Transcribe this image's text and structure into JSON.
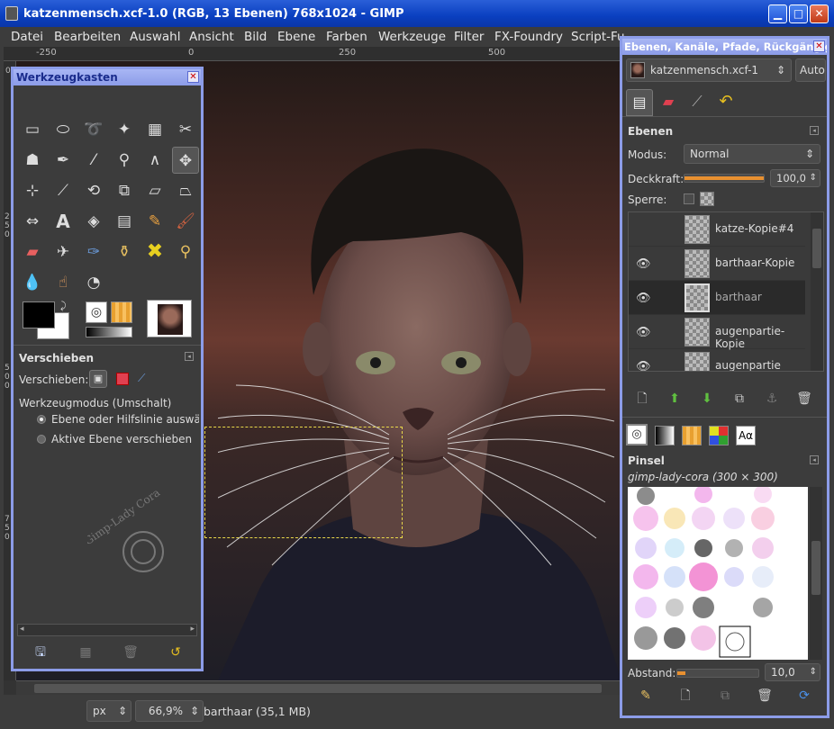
{
  "window": {
    "title": "katzenmensch.xcf-1.0 (RGB, 13 Ebenen) 768x1024 - GIMP",
    "min_label": "▁",
    "max_label": "□",
    "close_label": "✕"
  },
  "menu": [
    "Datei",
    "Bearbeiten",
    "Auswahl",
    "Ansicht",
    "Bild",
    "Ebene",
    "Farben",
    "Werkzeuge",
    "Filter",
    "FX-Foundry",
    "Script-Fu"
  ],
  "ruler": {
    "h": [
      "-250",
      "0",
      "250",
      "500"
    ],
    "v": [
      "0",
      "250",
      "500",
      "750"
    ]
  },
  "status": {
    "unit": "px",
    "zoom": "66,9%",
    "layer_info": "barthaar (35,1 MB)"
  },
  "toolbox": {
    "title": "Werkzeugkasten",
    "close": "✕",
    "section": "Verschieben",
    "move_label": "Verschieben:",
    "mode_label": "Werkzeugmodus (Umschalt)",
    "options": [
      "Ebene oder Hilfslinie auswählen",
      "Aktive Ebene verschieben"
    ],
    "watermark": "Gimp-Lady Cora"
  },
  "dock": {
    "title": "Ebenen, Kanäle, Pfade, Rückgängig - ...",
    "close": "✕",
    "image": "katzenmensch.xcf-1",
    "auto": "Auto",
    "layers_heading": "Ebenen",
    "mode_label": "Modus:",
    "mode_value": "Normal",
    "opacity_label": "Deckkraft:",
    "opacity_value": "100,0",
    "opacity": 1.0,
    "lock_label": "Sperre:",
    "layers": [
      {
        "name": "katze-Kopie#4",
        "visible": false,
        "selected": false
      },
      {
        "name": "barthaar-Kopie",
        "visible": true,
        "selected": false
      },
      {
        "name": "barthaar",
        "visible": true,
        "selected": true
      },
      {
        "name": "augenpartie-Kopie",
        "visible": true,
        "selected": false
      },
      {
        "name": "augenpartie",
        "visible": true,
        "selected": false
      }
    ],
    "brushes_heading": "Pinsel",
    "brush_set": "gimp-lady-cora (300 × 300)",
    "spacing_label": "Abstand:",
    "spacing_value": "10,0",
    "spacing": 0.1,
    "font_tab": "Aα"
  },
  "colors": {
    "accent": "#8c9ce8",
    "title_blue": "#0a3fc0",
    "selection": "#e9d84a"
  }
}
